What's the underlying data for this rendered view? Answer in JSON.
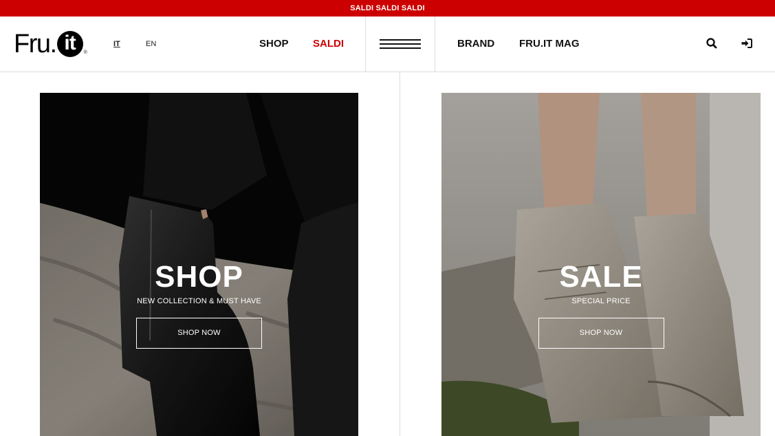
{
  "promo": {
    "text": "SALDI SALDI SALDI"
  },
  "header": {
    "logo": {
      "text": "Fru.",
      "circle": "it",
      "reg": "®"
    },
    "languages": [
      "IT",
      "EN"
    ],
    "nav_left": [
      "SHOP",
      "SALDI"
    ],
    "nav_right": [
      "BRAND",
      "FRU.IT MAG"
    ],
    "icons": {
      "search": "search-icon",
      "login": "login-icon",
      "menu": "menu-icon"
    }
  },
  "panels": [
    {
      "title": "SHOP",
      "subtitle": "NEW COLLECTION & MUST HAVE",
      "button": "SHOP NOW"
    },
    {
      "title": "SALE",
      "subtitle": "SPECIAL PRICE",
      "button": "SHOP NOW"
    }
  ],
  "colors": {
    "accent": "#cc0000"
  }
}
